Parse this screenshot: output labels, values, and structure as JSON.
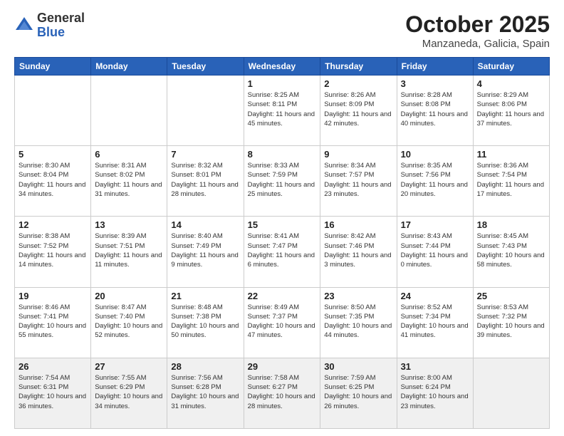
{
  "logo": {
    "general": "General",
    "blue": "Blue"
  },
  "header": {
    "month": "October 2025",
    "location": "Manzaneda, Galicia, Spain"
  },
  "weekdays": [
    "Sunday",
    "Monday",
    "Tuesday",
    "Wednesday",
    "Thursday",
    "Friday",
    "Saturday"
  ],
  "weeks": [
    [
      {
        "day": "",
        "info": ""
      },
      {
        "day": "",
        "info": ""
      },
      {
        "day": "",
        "info": ""
      },
      {
        "day": "1",
        "info": "Sunrise: 8:25 AM\nSunset: 8:11 PM\nDaylight: 11 hours and 45 minutes."
      },
      {
        "day": "2",
        "info": "Sunrise: 8:26 AM\nSunset: 8:09 PM\nDaylight: 11 hours and 42 minutes."
      },
      {
        "day": "3",
        "info": "Sunrise: 8:28 AM\nSunset: 8:08 PM\nDaylight: 11 hours and 40 minutes."
      },
      {
        "day": "4",
        "info": "Sunrise: 8:29 AM\nSunset: 8:06 PM\nDaylight: 11 hours and 37 minutes."
      }
    ],
    [
      {
        "day": "5",
        "info": "Sunrise: 8:30 AM\nSunset: 8:04 PM\nDaylight: 11 hours and 34 minutes."
      },
      {
        "day": "6",
        "info": "Sunrise: 8:31 AM\nSunset: 8:02 PM\nDaylight: 11 hours and 31 minutes."
      },
      {
        "day": "7",
        "info": "Sunrise: 8:32 AM\nSunset: 8:01 PM\nDaylight: 11 hours and 28 minutes."
      },
      {
        "day": "8",
        "info": "Sunrise: 8:33 AM\nSunset: 7:59 PM\nDaylight: 11 hours and 25 minutes."
      },
      {
        "day": "9",
        "info": "Sunrise: 8:34 AM\nSunset: 7:57 PM\nDaylight: 11 hours and 23 minutes."
      },
      {
        "day": "10",
        "info": "Sunrise: 8:35 AM\nSunset: 7:56 PM\nDaylight: 11 hours and 20 minutes."
      },
      {
        "day": "11",
        "info": "Sunrise: 8:36 AM\nSunset: 7:54 PM\nDaylight: 11 hours and 17 minutes."
      }
    ],
    [
      {
        "day": "12",
        "info": "Sunrise: 8:38 AM\nSunset: 7:52 PM\nDaylight: 11 hours and 14 minutes."
      },
      {
        "day": "13",
        "info": "Sunrise: 8:39 AM\nSunset: 7:51 PM\nDaylight: 11 hours and 11 minutes."
      },
      {
        "day": "14",
        "info": "Sunrise: 8:40 AM\nSunset: 7:49 PM\nDaylight: 11 hours and 9 minutes."
      },
      {
        "day": "15",
        "info": "Sunrise: 8:41 AM\nSunset: 7:47 PM\nDaylight: 11 hours and 6 minutes."
      },
      {
        "day": "16",
        "info": "Sunrise: 8:42 AM\nSunset: 7:46 PM\nDaylight: 11 hours and 3 minutes."
      },
      {
        "day": "17",
        "info": "Sunrise: 8:43 AM\nSunset: 7:44 PM\nDaylight: 11 hours and 0 minutes."
      },
      {
        "day": "18",
        "info": "Sunrise: 8:45 AM\nSunset: 7:43 PM\nDaylight: 10 hours and 58 minutes."
      }
    ],
    [
      {
        "day": "19",
        "info": "Sunrise: 8:46 AM\nSunset: 7:41 PM\nDaylight: 10 hours and 55 minutes."
      },
      {
        "day": "20",
        "info": "Sunrise: 8:47 AM\nSunset: 7:40 PM\nDaylight: 10 hours and 52 minutes."
      },
      {
        "day": "21",
        "info": "Sunrise: 8:48 AM\nSunset: 7:38 PM\nDaylight: 10 hours and 50 minutes."
      },
      {
        "day": "22",
        "info": "Sunrise: 8:49 AM\nSunset: 7:37 PM\nDaylight: 10 hours and 47 minutes."
      },
      {
        "day": "23",
        "info": "Sunrise: 8:50 AM\nSunset: 7:35 PM\nDaylight: 10 hours and 44 minutes."
      },
      {
        "day": "24",
        "info": "Sunrise: 8:52 AM\nSunset: 7:34 PM\nDaylight: 10 hours and 41 minutes."
      },
      {
        "day": "25",
        "info": "Sunrise: 8:53 AM\nSunset: 7:32 PM\nDaylight: 10 hours and 39 minutes."
      }
    ],
    [
      {
        "day": "26",
        "info": "Sunrise: 7:54 AM\nSunset: 6:31 PM\nDaylight: 10 hours and 36 minutes."
      },
      {
        "day": "27",
        "info": "Sunrise: 7:55 AM\nSunset: 6:29 PM\nDaylight: 10 hours and 34 minutes."
      },
      {
        "day": "28",
        "info": "Sunrise: 7:56 AM\nSunset: 6:28 PM\nDaylight: 10 hours and 31 minutes."
      },
      {
        "day": "29",
        "info": "Sunrise: 7:58 AM\nSunset: 6:27 PM\nDaylight: 10 hours and 28 minutes."
      },
      {
        "day": "30",
        "info": "Sunrise: 7:59 AM\nSunset: 6:25 PM\nDaylight: 10 hours and 26 minutes."
      },
      {
        "day": "31",
        "info": "Sunrise: 8:00 AM\nSunset: 6:24 PM\nDaylight: 10 hours and 23 minutes."
      },
      {
        "day": "",
        "info": ""
      }
    ]
  ]
}
